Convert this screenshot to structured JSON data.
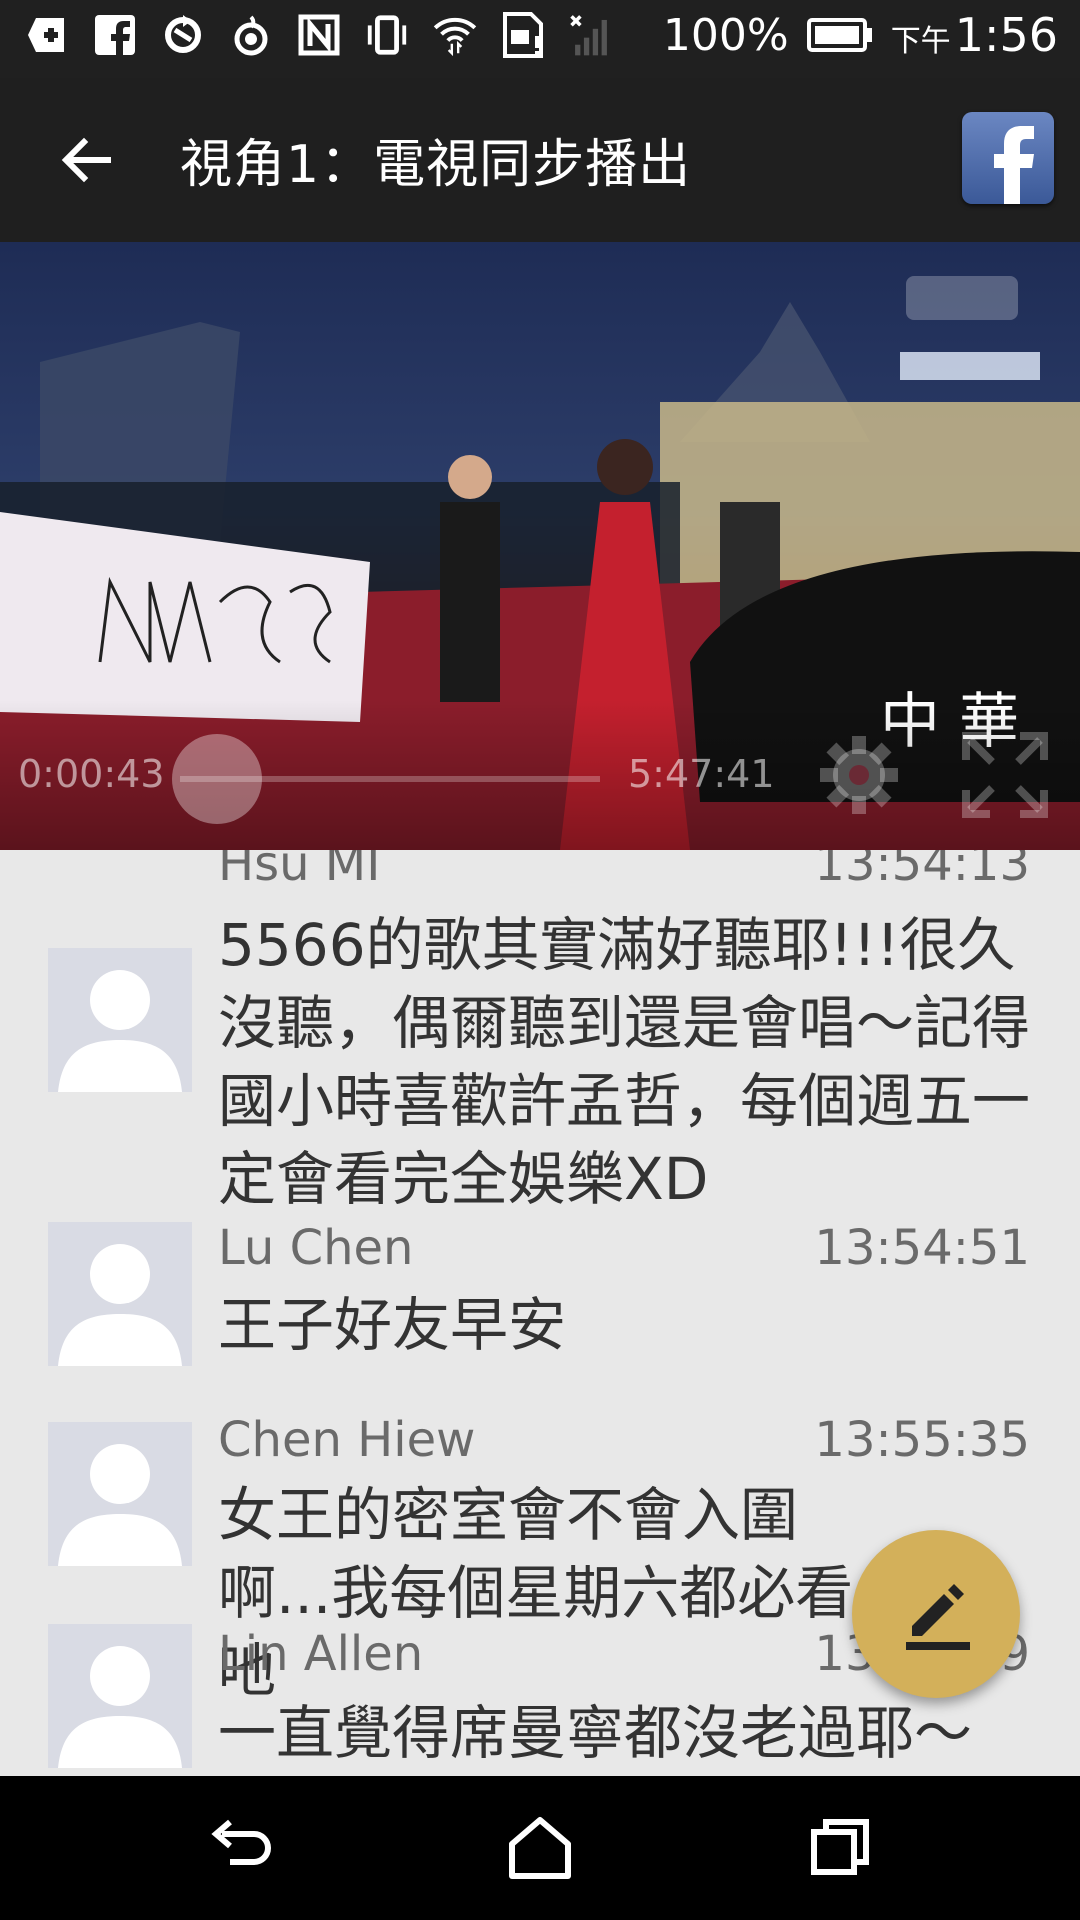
{
  "status_bar": {
    "battery_percent": "100%",
    "time_prefix": "下午",
    "time": "1:56",
    "icons": [
      "add-box-icon",
      "facebook-icon",
      "sync-icon",
      "hotspot-icon",
      "nfc-icon",
      "vibrate-icon",
      "wifi-icon",
      "sim-icon",
      "signal-off-icon",
      "battery-icon"
    ]
  },
  "app_bar": {
    "title": "視角1：電視同步播出",
    "back_icon": "arrow-back-icon",
    "share_icon": "facebook-icon"
  },
  "video": {
    "current_time": "0:00:43",
    "total_time": "5:47:41",
    "icons": [
      "settings-icon",
      "fullscreen-icon"
    ],
    "progress": 0.002,
    "accent": "#c8102e"
  },
  "comments": [
    {
      "name": "Hsu MI",
      "time": "13:54:13",
      "text": "5566的歌其實滿好聽耶!!!很久沒聽，偶爾聽到還是會唱～記得國小時喜歡許孟哲，每個週五一定會看完全娛樂XD"
    },
    {
      "name": "Lu Chen",
      "time": "13:54:51",
      "text": "王子好友早安"
    },
    {
      "name": "Chen Hiew",
      "time": "13:55:35",
      "text": "女王的密室會不會入圍啊...我每個星期六都必看吔"
    },
    {
      "name": "Lin Allen",
      "time": "13:56:29",
      "text": "一直覺得席曼寧都沒老過耶～"
    }
  ],
  "fab": {
    "icon": "edit-icon",
    "color": "#d3b05a"
  },
  "nav_bar": {
    "icons": [
      "back-icon",
      "home-icon",
      "recents-icon"
    ]
  }
}
